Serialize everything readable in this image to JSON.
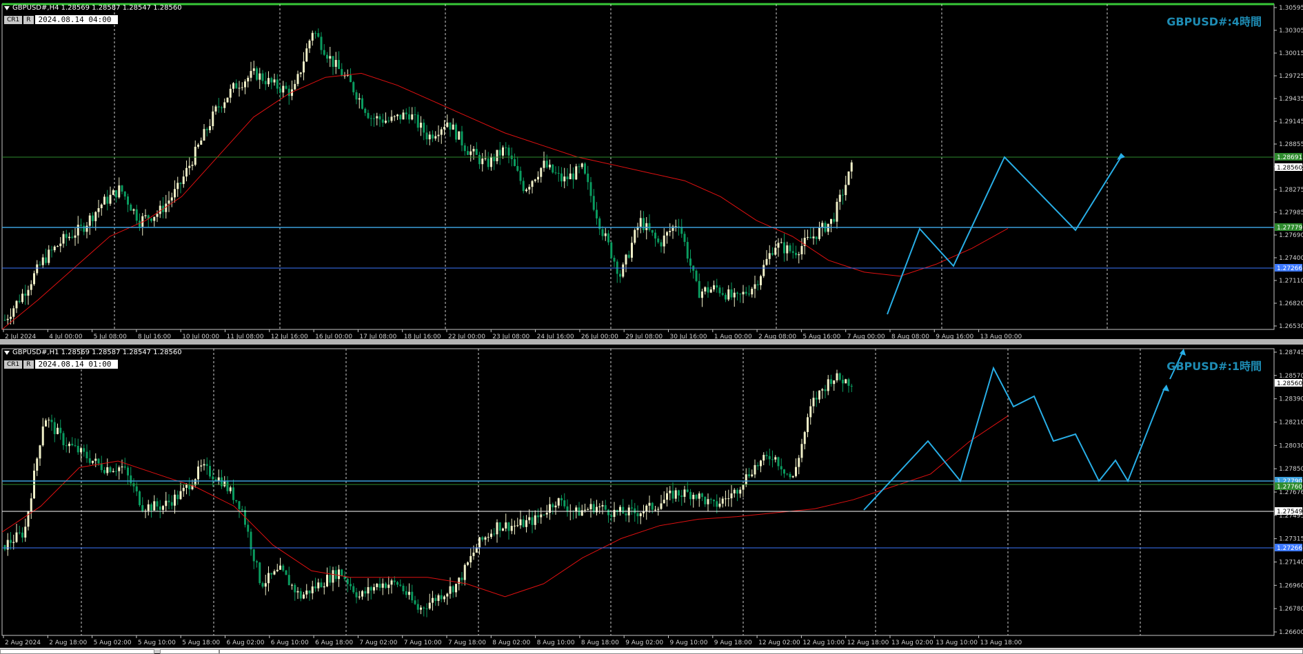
{
  "colors": {
    "bull": "#f0f0c8",
    "bear": "#0a9b5f",
    "ma": "#e01010",
    "trend": "#28aee6",
    "hline_blue": "#3c78ff",
    "hline_cyan": "#3ca0dc",
    "hline_green": "#2e8b2e",
    "label": "#1e8cb4"
  },
  "top": {
    "header": "GBPUSD#,H4  1.28569 1.28587 1.28547 1.28560",
    "badge1": "CR1",
    "badge2": "R",
    "time": "2024.08.14 04:00",
    "tf_label": "GBPUSD#:4時間",
    "price_axis": [
      "1.30595",
      "1.30305",
      "1.30015",
      "1.29725",
      "1.29435",
      "1.29145",
      "1.28855",
      "1.28565",
      "1.28275",
      "1.27985",
      "1.27690",
      "1.27400",
      "1.27110",
      "1.26820",
      "1.26530"
    ],
    "price_tags": {
      "green": "1.28691",
      "current": "1.28560",
      "cyan": "1.27779",
      "blue": "1.27266"
    },
    "time_axis": [
      "2 Jul 2024",
      "4 Jul 00:00",
      "5 Jul 08:00",
      "8 Jul 16:00",
      "10 Jul 00:00",
      "11 Jul 08:00",
      "12 Jul 16:00",
      "16 Jul 00:00",
      "17 Jul 08:00",
      "18 Jul 16:00",
      "22 Jul 00:00",
      "23 Jul 08:00",
      "24 Jul 16:00",
      "26 Jul 00:00",
      "29 Jul 08:00",
      "30 Jul 16:00",
      "1 Aug 00:00",
      "2 Aug 08:00",
      "5 Aug 16:00",
      "7 Aug 00:00",
      "8 Aug 08:00",
      "9 Aug 16:00",
      "13 Aug 00:00"
    ]
  },
  "bottom": {
    "header": "GBPUSD#,H1  1.28569 1.28587 1.28547 1.28560",
    "badge1": "CR1",
    "badge2": "R",
    "time": "2024.08.14 01:00",
    "tf_label": "GBPUSD#:1時間",
    "price_axis": [
      "1.28745",
      "1.28570",
      "1.28390",
      "1.28210",
      "1.28030",
      "1.27850",
      "1.27676",
      "1.27495",
      "1.27315",
      "1.27140",
      "1.26960",
      "1.26780",
      "1.26600"
    ],
    "price_tags": {
      "current": "1.28560",
      "cyan": "1.27790",
      "green": "1.27760",
      "white": "1.27549",
      "blue": "1.27266"
    },
    "time_axis": [
      "2 Aug 2024",
      "2 Aug 18:00",
      "5 Aug 02:00",
      "5 Aug 10:00",
      "5 Aug 18:00",
      "6 Aug 02:00",
      "6 Aug 10:00",
      "6 Aug 18:00",
      "7 Aug 02:00",
      "7 Aug 10:00",
      "7 Aug 18:00",
      "8 Aug 02:00",
      "8 Aug 10:00",
      "8 Aug 18:00",
      "9 Aug 02:00",
      "9 Aug 10:00",
      "9 Aug 18:00",
      "12 Aug 02:00",
      "12 Aug 10:00",
      "12 Aug 18:00",
      "13 Aug 02:00",
      "13 Aug 10:00",
      "13 Aug 18:00"
    ]
  },
  "chart_data": [
    {
      "type": "candlestick",
      "title": "GBPUSD#:4時間",
      "timeframe": "H4",
      "ylim": [
        1.2653,
        1.3062
      ],
      "ohlc_last": {
        "open": 1.28569,
        "high": 1.28587,
        "low": 1.28547,
        "close": 1.2856
      },
      "levels": [
        1.28691,
        1.27779,
        1.27266
      ],
      "close_path": [
        1.2665,
        1.27,
        1.274,
        1.2765,
        1.278,
        1.281,
        1.283,
        1.279,
        1.28,
        1.283,
        1.288,
        1.293,
        1.296,
        1.2975,
        1.296,
        1.295,
        1.303,
        1.299,
        1.296,
        1.292,
        1.2915,
        1.2925,
        1.2895,
        1.2915,
        1.288,
        1.286,
        1.288,
        1.283,
        1.286,
        1.284,
        1.2855,
        1.278,
        1.272,
        1.279,
        1.276,
        1.279,
        1.27,
        1.2705,
        1.269,
        1.271,
        1.276,
        1.275,
        1.277,
        1.279,
        1.2856
      ],
      "ma_path": [
        1.2653,
        1.269,
        1.273,
        1.277,
        1.279,
        1.282,
        1.287,
        1.292,
        1.295,
        1.297,
        1.2975,
        1.296,
        1.294,
        1.292,
        1.29,
        1.2885,
        1.287,
        1.286,
        1.285,
        1.284,
        1.282,
        1.279,
        1.277,
        1.274,
        1.2725,
        1.272,
        1.2735,
        1.2755,
        1.278
      ]
    },
    {
      "type": "candlestick",
      "title": "GBPUSD#:1時間",
      "timeframe": "H1",
      "ylim": [
        1.266,
        1.2882
      ],
      "ohlc_last": {
        "open": 1.28569,
        "high": 1.28587,
        "low": 1.28547,
        "close": 1.2856
      },
      "levels": [
        1.2779,
        1.2776,
        1.27549,
        1.27266
      ],
      "close_path": [
        1.273,
        1.274,
        1.283,
        1.281,
        1.28,
        1.279,
        1.279,
        1.276,
        1.276,
        1.277,
        1.279,
        1.278,
        1.276,
        1.27,
        1.271,
        1.269,
        1.27,
        1.271,
        1.269,
        1.27,
        1.27,
        1.268,
        1.269,
        1.27,
        1.273,
        1.2745,
        1.2745,
        1.275,
        1.2765,
        1.2755,
        1.276,
        1.2755,
        1.2755,
        1.276,
        1.277,
        1.277,
        1.276,
        1.277,
        1.279,
        1.28,
        1.278,
        1.284,
        1.286,
        1.2856
      ],
      "ma_path": [
        1.274,
        1.276,
        1.279,
        1.2795,
        1.2785,
        1.2775,
        1.276,
        1.273,
        1.271,
        1.2705,
        1.2705,
        1.2705,
        1.27,
        1.269,
        1.27,
        1.272,
        1.2735,
        1.2745,
        1.275,
        1.2752,
        1.2755,
        1.2758,
        1.2765,
        1.2775,
        1.2785,
        1.281,
        1.283
      ]
    }
  ]
}
